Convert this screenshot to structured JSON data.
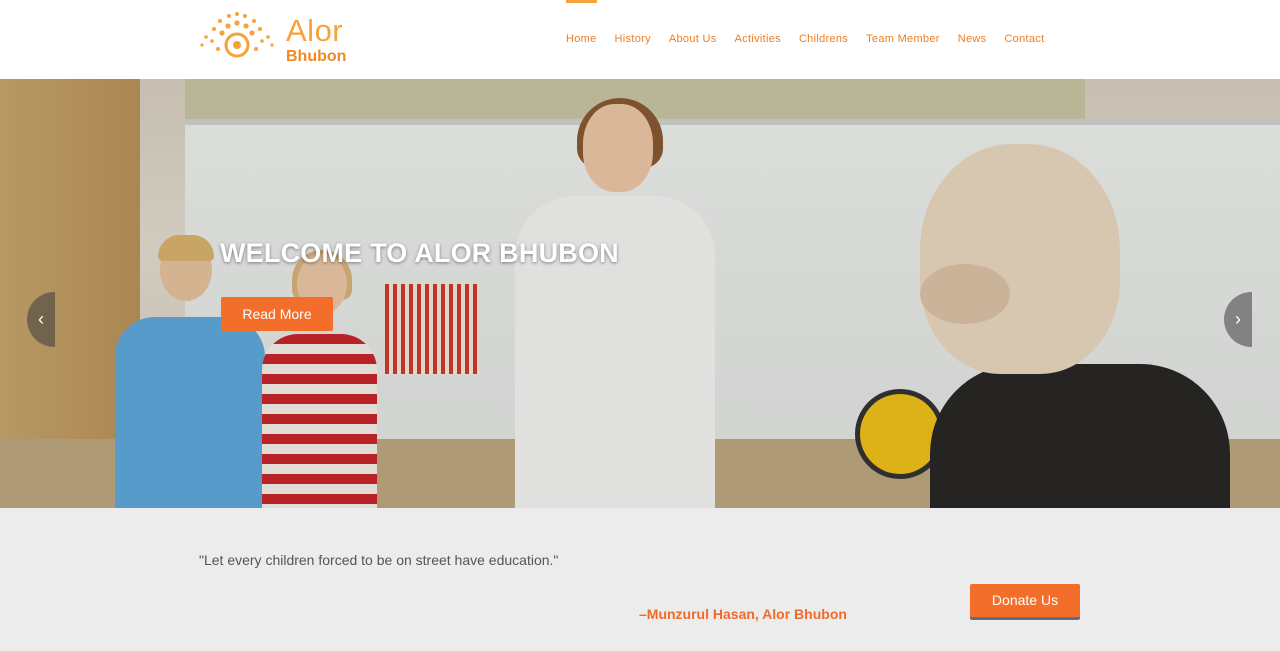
{
  "brand": {
    "name": "Alor",
    "subtitle": "Bhubon",
    "logo_icon": "sun-eye-logo-icon",
    "accent_color": "#f26e2a",
    "logo_color": "#f7a23b"
  },
  "nav": {
    "items": [
      {
        "label": "Home",
        "active": true
      },
      {
        "label": "History"
      },
      {
        "label": "About Us"
      },
      {
        "label": "Activities"
      },
      {
        "label": "Childrens"
      },
      {
        "label": "Team Member"
      },
      {
        "label": "News"
      },
      {
        "label": "Contact"
      }
    ]
  },
  "hero": {
    "title": "WELCOME TO ALOR BHUBON",
    "button_label": "Read More",
    "prev_icon": "chevron-left-icon",
    "next_icon": "chevron-right-icon",
    "prev_glyph": "‹",
    "next_glyph": "›"
  },
  "quote": {
    "text": "\"Let every children forced to be on street have education.\"",
    "author": "–Munzurul Hasan, Alor Bhubon",
    "donate_label": "Donate Us"
  }
}
